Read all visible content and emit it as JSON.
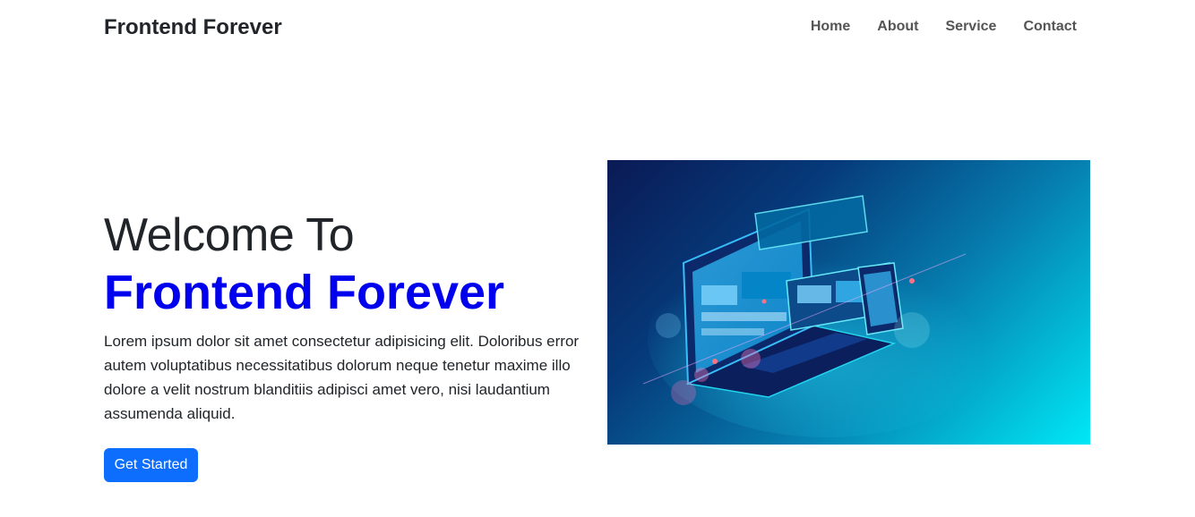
{
  "navbar": {
    "brand": "Frontend Forever",
    "links": [
      {
        "label": "Home"
      },
      {
        "label": "About"
      },
      {
        "label": "Service"
      },
      {
        "label": "Contact"
      }
    ]
  },
  "hero": {
    "welcome": "Welcome To",
    "title": "Frontend Forever",
    "description": "Lorem ipsum dolor sit amet consectetur adipisicing elit. Doloribus error autem voluptatibus necessitatibus dolorum neque tenetur maxime illo dolore a velit nostrum blanditiis adipisci amet vero, nisi laudantium assumenda aliquid.",
    "cta_label": "Get Started",
    "image_subject": "devices-illustration"
  },
  "colors": {
    "accent_title": "#0000ee",
    "button": "#0d6efd"
  }
}
